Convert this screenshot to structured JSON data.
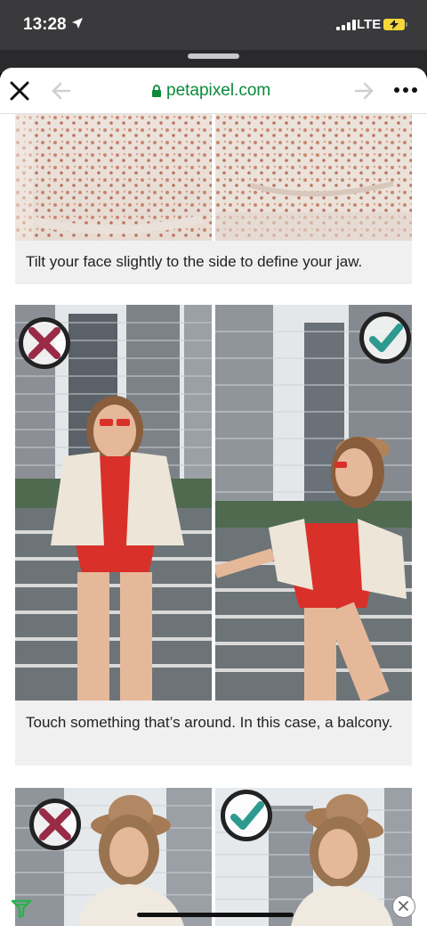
{
  "status_bar": {
    "time": "13:28",
    "network": "LTE"
  },
  "browser": {
    "url": "petapixel.com"
  },
  "article": {
    "captions": [
      "Tilt your face slightly to the side to define your jaw.",
      "Touch something that’s around. In this case, a balcony."
    ],
    "photos": [
      {
        "alt": "floral dress close-up, left"
      },
      {
        "alt": "floral dress close-up, right"
      },
      {
        "alt": "woman in red swimsuit standing straight",
        "verdict": "wrong"
      },
      {
        "alt": "woman in red swimsuit leaning on balcony railing",
        "verdict": "right"
      },
      {
        "alt": "woman in hat facing camera",
        "verdict": "wrong"
      },
      {
        "alt": "woman in hat tilting head",
        "verdict": "right"
      }
    ]
  },
  "colors": {
    "wrong_mark": "#9a2b47",
    "right_mark": "#2e9a8f",
    "url_green": "#0a8a3a",
    "swimsuit_red": "#d9302a"
  },
  "icons": [
    "location-arrow-icon",
    "signal-icon",
    "battery-icon",
    "close-icon",
    "back-arrow-icon",
    "lock-icon",
    "forward-arrow-icon",
    "more-icon",
    "x-mark-icon",
    "check-mark-icon",
    "feedly-icon",
    "close-ad-icon"
  ]
}
